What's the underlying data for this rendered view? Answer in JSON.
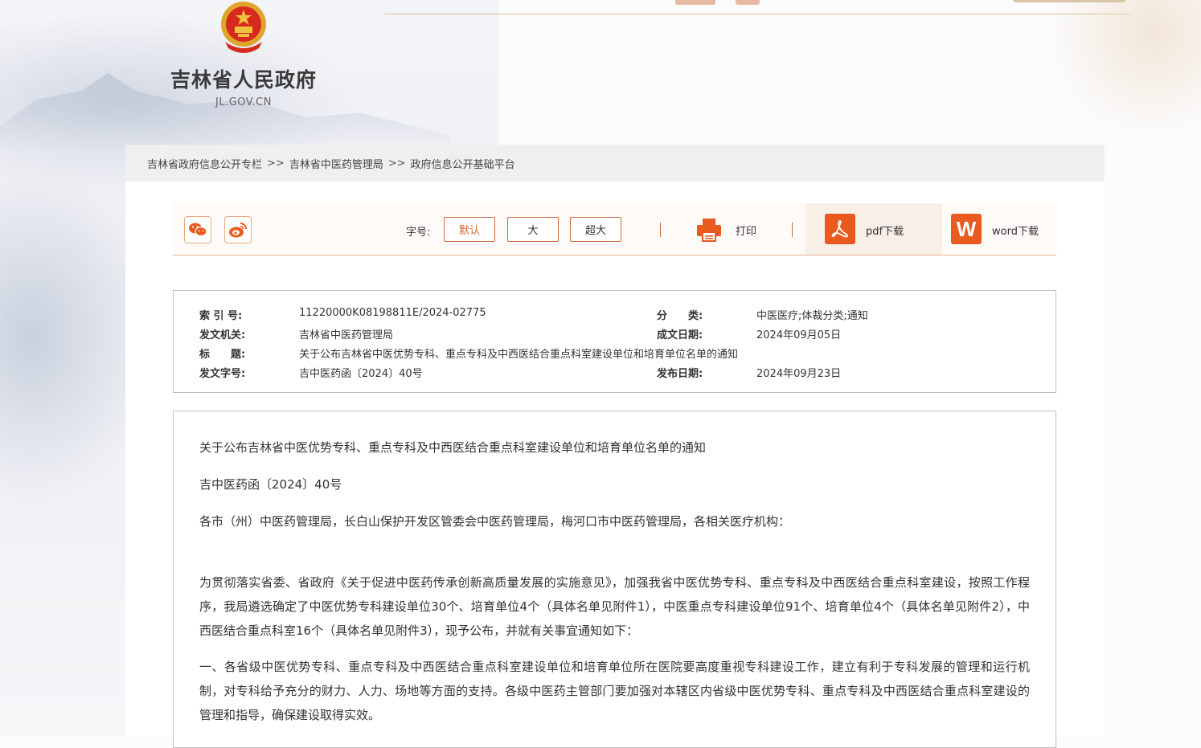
{
  "site": {
    "name": "吉林省人民政府",
    "domain": "JL.GOV.CN"
  },
  "breadcrumb": {
    "items": [
      "吉林省政府信息公开专栏",
      "吉林省中医药管理局",
      "政府信息公开基础平台"
    ],
    "separator": ">>"
  },
  "toolbar": {
    "share_wechat_icon": "wechat-icon",
    "share_weibo_icon": "weibo-icon",
    "fontsize_label": "字号:",
    "fontsize_default": "默认",
    "fontsize_large": "大",
    "fontsize_xlarge": "超大",
    "print_label": "打印",
    "pdf_label": "pdf下载",
    "word_label": "word下载",
    "accent": "#e85a1e"
  },
  "meta": {
    "index_label": "索 引 号:",
    "index_value": "11220000K08198811E/2024-02775",
    "category_label": "分　　类:",
    "category_value": "中医医疗;体裁分类;通知",
    "issuer_label": "发文机关:",
    "issuer_value": "吉林省中医药管理局",
    "date_written_label": "成文日期:",
    "date_written_value": "2024年09月05日",
    "title_label": "标　　题:",
    "title_value": "关于公布吉林省中医优势专科、重点专科及中西医结合重点科室建设单位和培育单位名单的通知",
    "doc_no_label": "发文字号:",
    "doc_no_value": "吉中医药函〔2024〕40号",
    "date_published_label": "发布日期:",
    "date_published_value": "2024年09月23日"
  },
  "content": {
    "title": "关于公布吉林省中医优势专科、重点专科及中西医结合重点科室建设单位和培育单位名单的通知",
    "doc_no": "吉中医药函〔2024〕40号",
    "recipients": "各市（州）中医药管理局，长白山保护开发区管委会中医药管理局，梅河口市中医药管理局，各相关医疗机构：",
    "para1": "为贯彻落实省委、省政府《关于促进中医药传承创新高质量发展的实施意见》，加强我省中医优势专科、重点专科及中西医结合重点科室建设，按照工作程序，我局遴选确定了中医优势专科建设单位30个、培育单位4个（具体名单见附件1），中医重点专科建设单位91个、培育单位4个（具体名单见附件2），中西医结合重点科室16个（具体名单见附件3），现予公布，并就有关事宜通知如下：",
    "para2": "一、各省级中医优势专科、重点专科及中西医结合重点科室建设单位和培育单位所在医院要高度重视专科建设工作，建立有利于专科发展的管理和运行机制，对专科给予充分的财力、人力、场地等方面的支持。各级中医药主管部门要加强对本辖区内省级中医优势专科、重点专科及中西医结合重点科室建设的管理和指导，确保建设取得实效。"
  }
}
